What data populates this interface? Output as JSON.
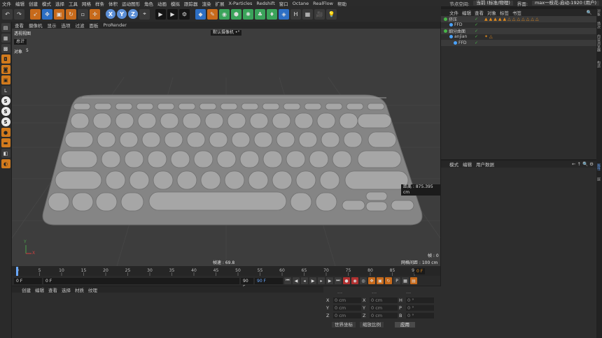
{
  "menubar": {
    "items": [
      "文件",
      "编辑",
      "创建",
      "模式",
      "选择",
      "工具",
      "网格",
      "样条",
      "体积",
      "运动图形",
      "角色",
      "动画",
      "模拟",
      "跟踪器",
      "渲染",
      "扩展",
      "X-Particles",
      "Redshift",
      "窗口",
      "Octane",
      "RealFlow",
      "帮助"
    ],
    "node_space_label": "节点空间:",
    "node_space_value": "当前 (标准/物理)",
    "interface_label": "界面:",
    "interface_value": "max一枝花-启动-1920 (用户)"
  },
  "viewport": {
    "menu": [
      "查看",
      "摄像机",
      "显示",
      "选项",
      "过滤",
      "面板",
      "ProRender"
    ],
    "view_name": "透视视图",
    "camera_name": "默认摄像机 •°",
    "stats_header": "总计",
    "stats_label": "对象",
    "stats_value": "5",
    "distance_label": "距离 : 875.395 cm",
    "fps_label": "帧速 : 69.8",
    "frame_label": "帧 : 0",
    "grid_label": "网格间距 : 100 cm",
    "axis_x": "X",
    "axis_y": "Y"
  },
  "timeline": {
    "ticks": [
      "0",
      "5",
      "10",
      "15",
      "20",
      "25",
      "30",
      "35",
      "40",
      "45",
      "50",
      "55",
      "60",
      "65",
      "70",
      "75",
      "80",
      "85",
      "90"
    ],
    "current_frame": "0 F"
  },
  "playbar": {
    "start": "0 F",
    "current": "0 F",
    "end": "90 F",
    "end2": "90 F"
  },
  "material": {
    "menu": [
      "创建",
      "编辑",
      "查看",
      "选择",
      "材质",
      "纹理"
    ]
  },
  "coords": {
    "rows": [
      {
        "a": "X",
        "av": "0 cm",
        "b": "X",
        "bv": "0 cm",
        "c": "H",
        "cv": "0 °"
      },
      {
        "a": "Y",
        "av": "0 cm",
        "b": "Y",
        "bv": "0 cm",
        "c": "P",
        "cv": "0 °"
      },
      {
        "a": "Z",
        "av": "0 cm",
        "b": "Z",
        "bv": "0 cm",
        "c": "B",
        "cv": "0 °"
      }
    ],
    "mode1": "世界坐标",
    "mode2": "缩放比例",
    "apply": "应用",
    "header": "---"
  },
  "objects": {
    "menu": [
      "文件",
      "编辑",
      "查看",
      "对象",
      "标签",
      "书签"
    ],
    "rows": [
      {
        "name": "挤压",
        "color": "#4aa3ff",
        "indent": 0
      },
      {
        "name": "FFD",
        "color": "#4aa3ff",
        "indent": 8
      },
      {
        "name": "细分曲面",
        "color": "#4aa3ff",
        "indent": 0
      },
      {
        "name": "anjian",
        "color": "#4aa3ff",
        "indent": 8
      },
      {
        "name": "FFD",
        "color": "#4aa3ff",
        "indent": 12
      }
    ]
  },
  "attributes": {
    "menu": [
      "模式",
      "编辑",
      "用户数据"
    ]
  },
  "right_tabs": [
    "对象",
    "场次",
    "内容浏览器",
    "构造",
    "属性",
    "层"
  ]
}
